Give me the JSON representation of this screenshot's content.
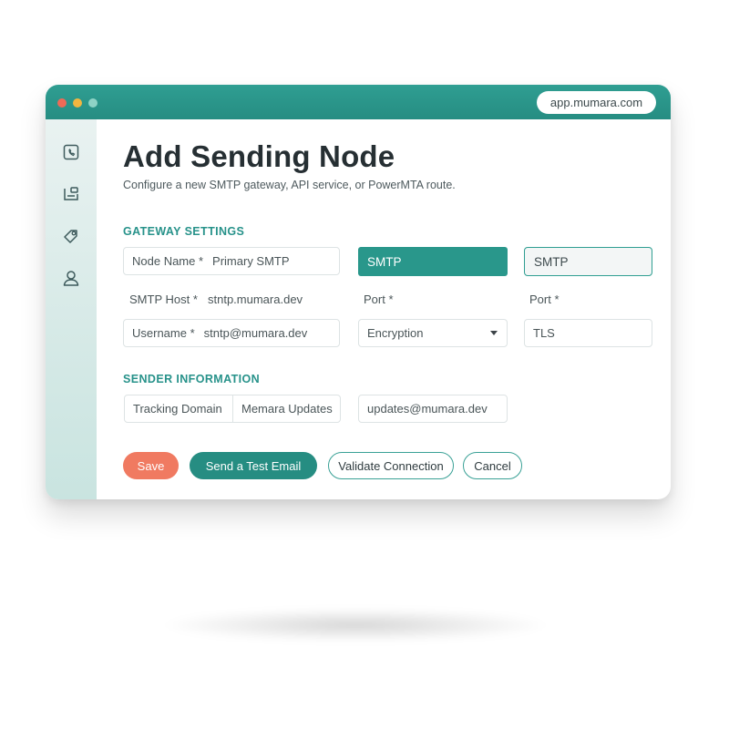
{
  "window": {
    "url": "app.mumara.com",
    "traffic_lights": {
      "close": "#ee6a57",
      "minimize": "#f2b640",
      "maximize": "#8ed3c6"
    },
    "accent_color": "#2f9e92"
  },
  "sidebar": {
    "items": [
      {
        "icon": "phone-icon"
      },
      {
        "icon": "inbox-icon"
      },
      {
        "icon": "tag-icon"
      },
      {
        "icon": "user-icon"
      }
    ]
  },
  "page": {
    "title": "Add Sending Node",
    "subtitle": "Configure a new SMTP gateway, API service, or PowerMTA route."
  },
  "gateway": {
    "section_title": "GATEWAY SETTINGS",
    "node_name": {
      "label": "Node Name *",
      "value": "Primary SMTP"
    },
    "type_selected": "SMTP",
    "type_outline": "SMTP",
    "smtp_host": {
      "label": "SMTP Host *",
      "value": "stntp.mumara.dev"
    },
    "port_label_1": "Port *",
    "port_label_2": "Port *",
    "username": {
      "label": "Username *",
      "value": "stntp@mumara.dev"
    },
    "encryption": {
      "label": "Encryption"
    },
    "tls_value": "TLS"
  },
  "sender": {
    "section_title": "SENDER INFORMATION",
    "tracking_domain_label": "Tracking Domain",
    "from_name": "Memara Updates",
    "from_email": "updates@mumara.dev"
  },
  "actions": {
    "save": "Save",
    "send_test": "Send a Test Email",
    "validate": "Validate Connection",
    "cancel": "Cancel"
  }
}
